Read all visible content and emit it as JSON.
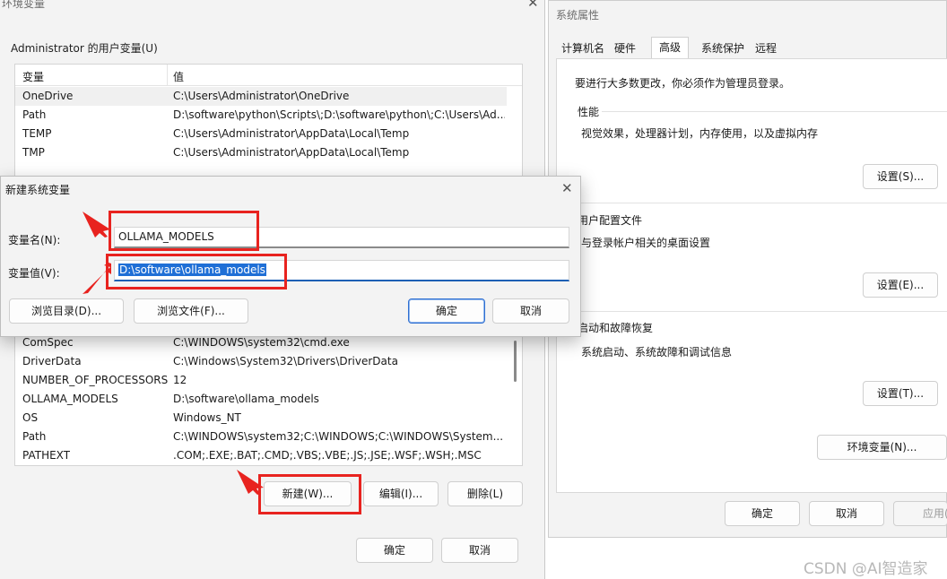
{
  "env_dialog": {
    "title": "环境变量",
    "user_group_label": "Administrator 的用户变量(U)",
    "col_variable": "变量",
    "col_value": "值",
    "user_vars": [
      {
        "name": "OneDrive",
        "value": "C:\\Users\\Administrator\\OneDrive"
      },
      {
        "name": "Path",
        "value": "D:\\software\\python\\Scripts\\;D:\\software\\python\\;C:\\Users\\Ad..."
      },
      {
        "name": "TEMP",
        "value": "C:\\Users\\Administrator\\AppData\\Local\\Temp"
      },
      {
        "name": "TMP",
        "value": "C:\\Users\\Administrator\\AppData\\Local\\Temp"
      }
    ],
    "system_vars": [
      {
        "name": "ComSpec",
        "value": "C:\\WINDOWS\\system32\\cmd.exe"
      },
      {
        "name": "DriverData",
        "value": "C:\\Windows\\System32\\Drivers\\DriverData"
      },
      {
        "name": "NUMBER_OF_PROCESSORS",
        "value": "12"
      },
      {
        "name": "OLLAMA_MODELS",
        "value": "D:\\software\\ollama_models"
      },
      {
        "name": "OS",
        "value": "Windows_NT"
      },
      {
        "name": "Path",
        "value": "C:\\WINDOWS\\system32;C:\\WINDOWS;C:\\WINDOWS\\System..."
      },
      {
        "name": "PATHEXT",
        "value": ".COM;.EXE;.BAT;.CMD;.VBS;.VBE;.JS;.JSE;.WSF;.WSH;.MSC"
      }
    ],
    "btn_new": "新建(W)...",
    "btn_edit": "编辑(I)...",
    "btn_delete": "删除(L)",
    "btn_ok": "确定",
    "btn_cancel": "取消"
  },
  "sys_props": {
    "title": "系统属性",
    "tabs": [
      "计算机名",
      "硬件",
      "高级",
      "系统保护",
      "远程"
    ],
    "admin_note": "要进行大多数更改，你必须作为管理员登录。",
    "perf_title": "性能",
    "perf_desc": "视觉效果，处理器计划，内存使用，以及虚拟内存",
    "perf_btn": "设置(S)...",
    "profile_title": "用户配置文件",
    "profile_desc": "与登录帐户相关的桌面设置",
    "profile_btn": "设置(E)...",
    "startup_title": "启动和故障恢复",
    "startup_desc": "系统启动、系统故障和调试信息",
    "startup_btn": "设置(T)...",
    "env_btn": "环境变量(N)...",
    "ok": "确定",
    "cancel": "取消",
    "apply": "应用(A)"
  },
  "new_var_dialog": {
    "title": "新建系统变量",
    "name_label": "变量名(N):",
    "value_label": "变量值(V):",
    "name_value": "OLLAMA_MODELS",
    "value_value": "D:\\software\\ollama_models",
    "browse_dir": "浏览目录(D)...",
    "browse_file": "浏览文件(F)...",
    "ok": "确定",
    "cancel": "取消"
  },
  "watermark": "CSDN @AI智造家",
  "colors": {
    "annotation_red": "#e8231f",
    "accent_blue": "#1f6fd6"
  }
}
